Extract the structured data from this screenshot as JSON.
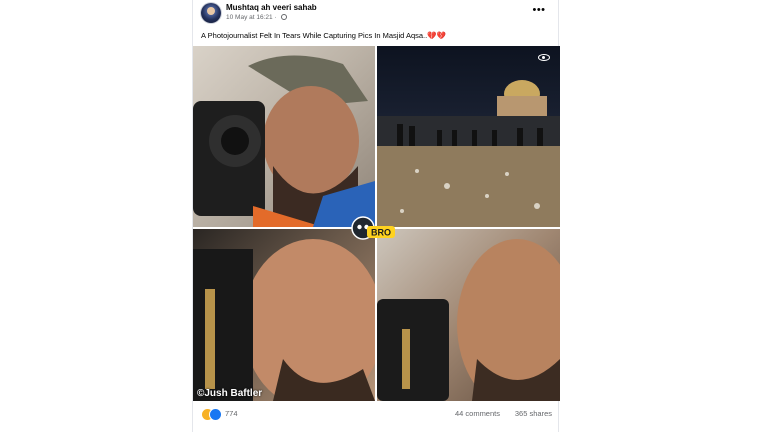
{
  "post": {
    "author": "Mushtaq ah veeri sahab",
    "date": "10 May at 16:21",
    "audience_icon": "globe-icon",
    "more_icon": "more-dots-icon",
    "more_glyph": "•••",
    "caption": "A Photojournalist Felt In Tears While Capturing Pics In Masjid Aqsa..",
    "caption_hearts": "💔💔"
  },
  "media": {
    "photos": [
      {
        "name": "photojournalist-crying-photo-1"
      },
      {
        "name": "masjid-aqsa-night-photo"
      },
      {
        "name": "photojournalist-crying-photo-2"
      },
      {
        "name": "photojournalist-crying-photo-3"
      }
    ],
    "watermark": "©Jush Baftler",
    "overlay_logo_text": "BRO",
    "view_icon": "eye-icon"
  },
  "footer": {
    "reactions": [
      "sad-reaction-icon",
      "like-reaction-icon"
    ],
    "reaction_count": "774",
    "comments": "44 comments",
    "shares": "365 shares"
  },
  "colors": {
    "text_primary": "#050505",
    "text_secondary": "#65676b",
    "like_blue": "#1877f2",
    "sad_yellow": "#f7b125",
    "heart_red": "#e0245e"
  }
}
